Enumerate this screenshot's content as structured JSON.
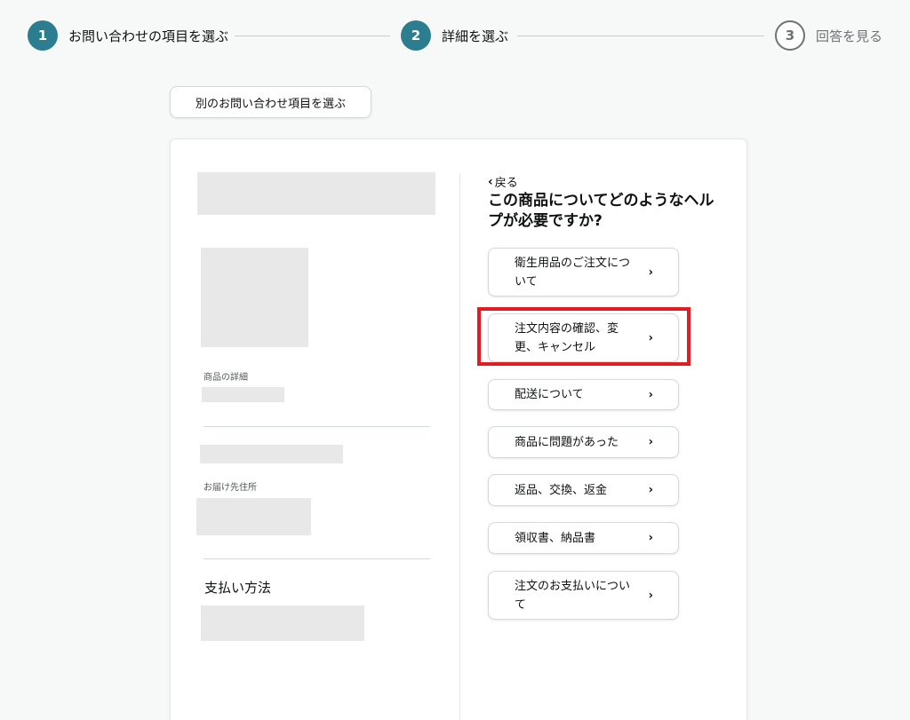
{
  "stepper": {
    "steps": [
      {
        "number": "1",
        "label": "お問い合わせの項目を選ぶ"
      },
      {
        "number": "2",
        "label": "詳細を選ぶ"
      },
      {
        "number": "3",
        "label": "回答を見る"
      }
    ]
  },
  "other_topic_button": "別のお問い合わせ項目を選ぶ",
  "left_panel": {
    "product_details_label": "商品の詳細",
    "shipping_address_label": "お届け先住所",
    "payment_method_title": "支払い方法"
  },
  "right_panel": {
    "back_label": "戻る",
    "question": "この商品についてどのようなヘルプが必要ですか?",
    "options": [
      {
        "label": "衛生用品のご注文について"
      },
      {
        "label": "注文内容の確認、変更、キャンセル"
      },
      {
        "label": "配送について"
      },
      {
        "label": "商品に問題があった"
      },
      {
        "label": "返品、交換、返金"
      },
      {
        "label": "領収書、納品書"
      },
      {
        "label": "注文のお支払いについて"
      }
    ]
  },
  "colors": {
    "accent": "#2c7d8f",
    "highlight": "#e31b23",
    "background": "#f7f8f8"
  }
}
